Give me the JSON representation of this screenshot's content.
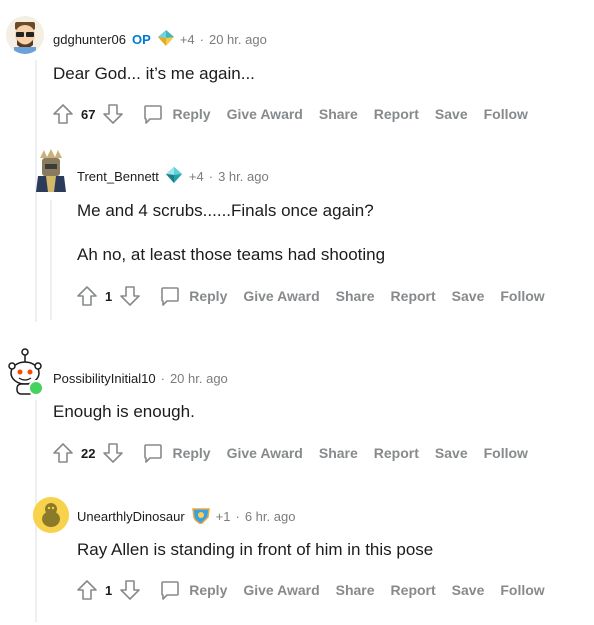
{
  "comments": [
    {
      "username": "gdghunter06",
      "op_label": "OP",
      "award_count": "+4",
      "timestamp": "20 hr. ago",
      "body": [
        "Dear God... it’s me again..."
      ],
      "score": "67",
      "flair_icon": "gold-gem-award-icon"
    },
    {
      "username": "Trent_Bennett",
      "award_count": "+4",
      "timestamp": "3 hr. ago",
      "body": [
        "Me and 4 scrubs......Finals once again?",
        "Ah no, at least those teams had shooting"
      ],
      "score": "1",
      "flair_icon": "teal-gem-award-icon"
    },
    {
      "username": "PossibilityInitial10",
      "timestamp": "20 hr. ago",
      "body": [
        "Enough is enough."
      ],
      "score": "22",
      "online_status": "green"
    },
    {
      "username": "UnearthlyDinosaur",
      "award_count": "+1",
      "timestamp": "6 hr. ago",
      "body": [
        "Ray Allen is standing in front of him in this pose"
      ],
      "score": "1",
      "flair_icon": "shield-award-icon"
    }
  ],
  "actions": {
    "reply": "Reply",
    "give_award": "Give Award",
    "share": "Share",
    "report": "Report",
    "save": "Save",
    "follow": "Follow"
  },
  "colors": {
    "op_blue": "#0079d3",
    "muted_gray": "#7c7c7c",
    "action_gray": "#878a8c",
    "thread_line": "#edeff1",
    "online_green": "#46d160"
  }
}
